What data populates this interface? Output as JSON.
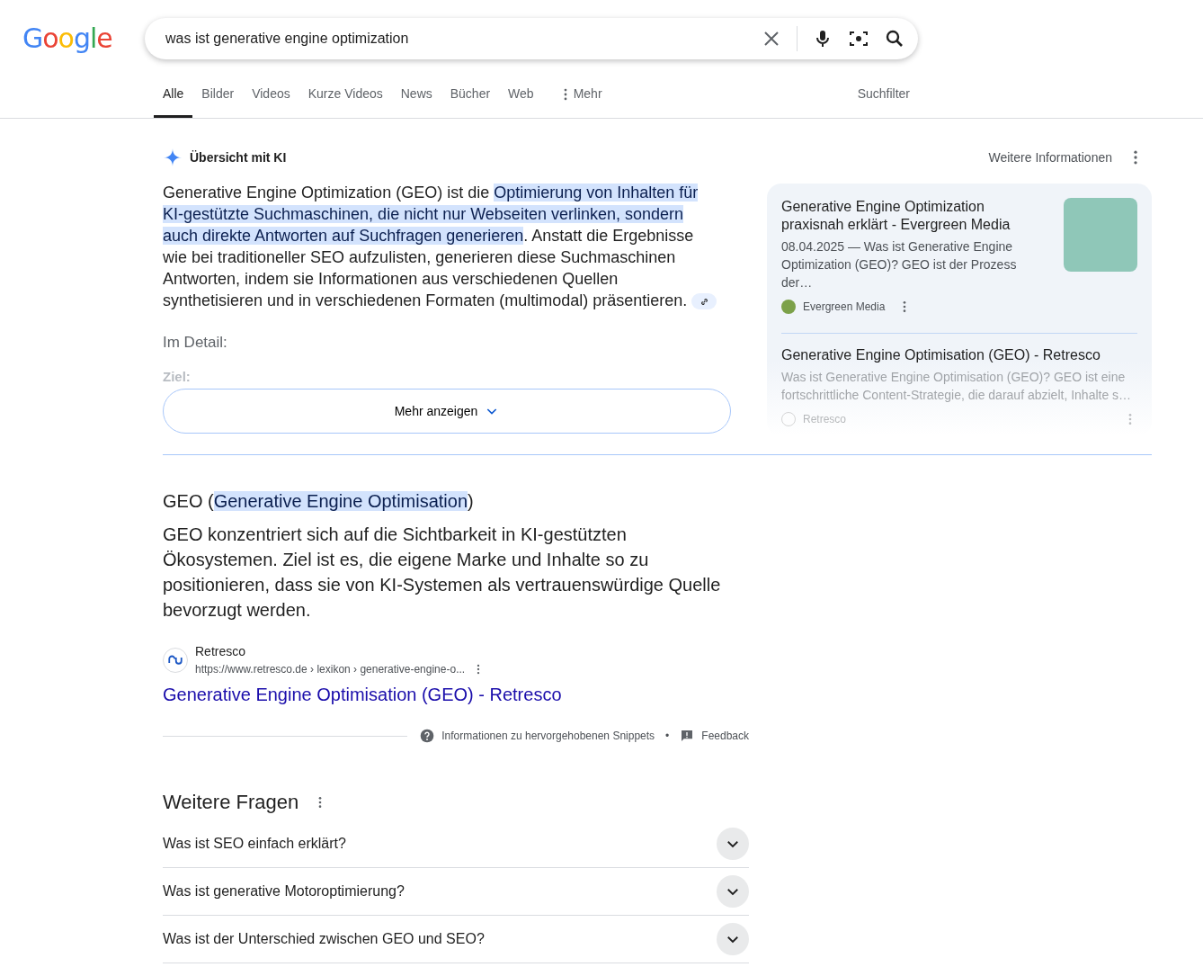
{
  "logo": "Google",
  "search": {
    "value": "was ist generative engine optimization"
  },
  "tabs": [
    {
      "label": "Alle",
      "selected": true
    },
    {
      "label": "Bilder",
      "selected": false
    },
    {
      "label": "Videos",
      "selected": false
    },
    {
      "label": "Kurze Videos",
      "selected": false
    },
    {
      "label": "News",
      "selected": false
    },
    {
      "label": "Bücher",
      "selected": false
    },
    {
      "label": "Web",
      "selected": false
    },
    {
      "label": "Mehr",
      "selected": false,
      "kind": "more"
    }
  ],
  "filter": "Suchfilter",
  "ai_overview": {
    "title": "Übersicht mit KI",
    "more_info": "Weitere Informationen",
    "paragraph": [
      {
        "text": "Generative Engine Optimization (GEO) ist die ",
        "highlighted": false
      },
      {
        "text": "Optimierung von Inhalten für KI-gestützte Suchmaschinen, die nicht nur Webseiten verlinken, sondern auch direkte Antworten auf Suchfragen generieren",
        "highlighted": true
      },
      {
        "text": ". Anstatt die Ergebnisse wie bei traditioneller SEO aufzulisten, generieren diese Suchmaschinen Antworten, indem sie Informationen aus verschiedenen Quellen synthetisieren und in verschiedenen Formaten (multimodal) präsentieren.",
        "highlighted": false
      }
    ],
    "subheading": "Im Detail:",
    "faded_heading": "Ziel:",
    "show_more": "Mehr anzeigen",
    "sources": [
      {
        "title": "Generative Engine Optimization praxisnah erklärt - Evergreen Media",
        "snippet": "08.04.2025 — Was ist Generative Engine Optimization (GEO)? GEO ist der Prozess der…",
        "site": "Evergreen Media",
        "faded": false
      },
      {
        "title": "Generative Engine Optimisation (GEO) - Retresco",
        "snippet": "Was ist Generative Engine Optimisation (GEO)? GEO ist eine fortschrittliche Content-Strategie, die darauf abzielt, Inhalte s…",
        "site": "Retresco",
        "faded": true
      }
    ]
  },
  "snippet": {
    "heading": [
      {
        "text": "GEO (",
        "highlighted": false
      },
      {
        "text": "Generative Engine Optimisation",
        "highlighted": true
      },
      {
        "text": ")",
        "highlighted": false
      }
    ],
    "text": "GEO konzentriert sich auf die Sichtbarkeit in KI-gestützten Ökosystemen. Ziel ist es, die eigene Marke und Inhalte so zu positionieren, dass sie von KI-Systemen als vertrauenswürdige Quelle bevorzugt werden.",
    "site": "Retresco",
    "url": "https://www.retresco.de › lexikon › generative-engine-o...",
    "link": "Generative Engine Optimisation (GEO) - Retresco",
    "about": "Informationen zu hervorgehobenen Snippets",
    "separator": "•",
    "feedback": "Feedback"
  },
  "questions": {
    "title": "Weitere Fragen",
    "items": [
      {
        "text": "Was ist SEO einfach erklärt?",
        "expanded": false
      },
      {
        "text": "Was ist generative Motoroptimierung?",
        "expanded": false
      },
      {
        "text": "Was ist der Unterschied zwischen GEO und SEO?",
        "expanded": false
      }
    ]
  }
}
